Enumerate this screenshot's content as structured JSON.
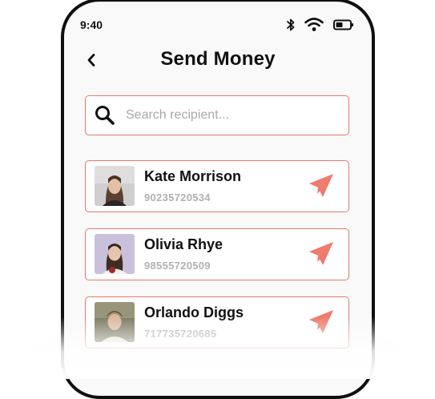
{
  "status_bar": {
    "time": "9:40",
    "icons": [
      "bluetooth-icon",
      "wifi-icon",
      "battery-icon"
    ]
  },
  "header": {
    "title": "Send Money",
    "back_icon": "chevron-left-icon"
  },
  "search": {
    "placeholder": "Search recipient...",
    "value": "",
    "icon": "search-icon"
  },
  "contacts": [
    {
      "name": "Kate Morrison",
      "phone": "90235720534",
      "avatar": "avatar-photo",
      "action_icon": "send-icon"
    },
    {
      "name": "Olivia Rhye",
      "phone": "98555720509",
      "avatar": "avatar-photo",
      "action_icon": "send-icon"
    },
    {
      "name": "Orlando Diggs",
      "phone": "717735720685",
      "avatar": "avatar-photo",
      "action_icon": "send-icon"
    }
  ],
  "colors": {
    "accent": "#e8776b",
    "send_icon": "#ee7b6c",
    "background": "#f9f9f9",
    "text_primary": "#111111",
    "text_secondary": "#b1b1b1",
    "phone_frame": "#0f0f0f"
  }
}
